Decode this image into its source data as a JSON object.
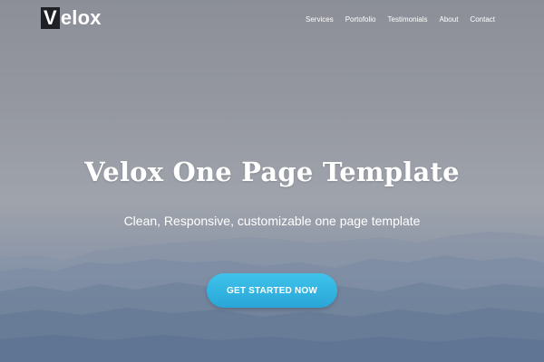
{
  "brand": {
    "logo_initial": "V",
    "logo_rest": "elox"
  },
  "nav": {
    "items": [
      {
        "label": "Services"
      },
      {
        "label": "Portofolio"
      },
      {
        "label": "Testimonials"
      },
      {
        "label": "About"
      },
      {
        "label": "Contact"
      }
    ]
  },
  "hero": {
    "title": "Velox One Page Template",
    "subtitle": "Clean, Responsive, customizable one page template",
    "cta_label": "GET STARTED NOW",
    "background_image": "misty-mountains"
  },
  "colors": {
    "accent": "#35b6e2",
    "text": "#ffffff",
    "logo_mark": "#1f1f26"
  }
}
